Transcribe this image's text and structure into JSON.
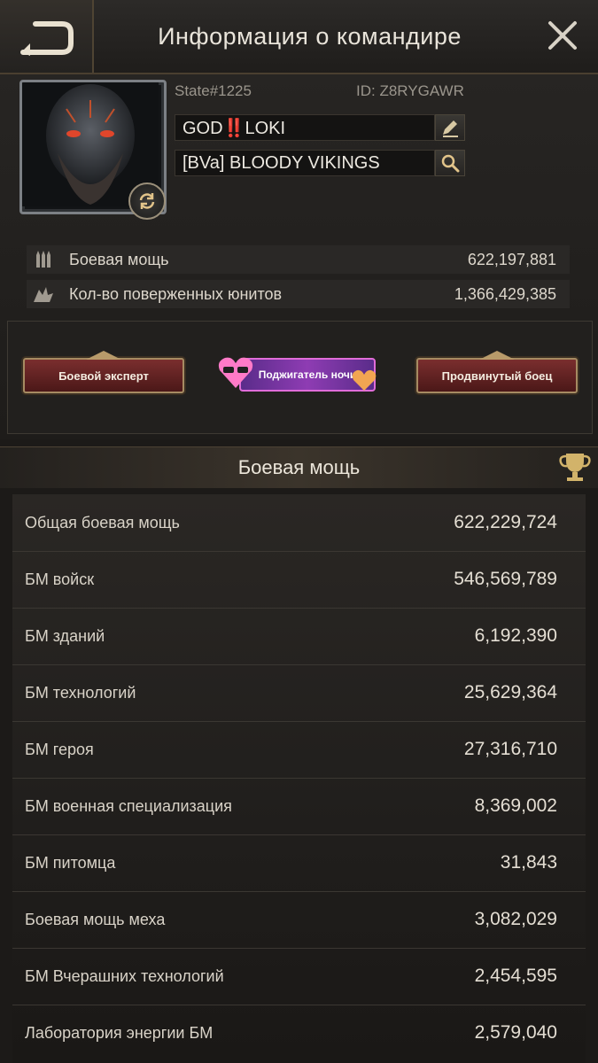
{
  "header": {
    "title": "Информация о командире"
  },
  "profile": {
    "state": "State#1225",
    "id": "ID: Z8RYGAWR",
    "name": "GOD‼️LOKI",
    "alliance": "[BVa] BLOODY VIKINGS"
  },
  "stats": [
    {
      "label": "Боевая мощь",
      "value": "622,197,881",
      "icon": "bullets-icon"
    },
    {
      "label": "Кол-во поверженных юнитов",
      "value": "1,366,429,385",
      "icon": "kills-icon"
    }
  ],
  "badges": {
    "left": "Боевой эксперт",
    "center": "Поджигатель ночи",
    "right": "Продвинутый боец"
  },
  "power": {
    "title": "Боевая мощь",
    "rows": [
      {
        "label": "Общая боевая мощь",
        "value": "622,229,724"
      },
      {
        "label": "БМ войск",
        "value": "546,569,789"
      },
      {
        "label": "БМ зданий",
        "value": "6,192,390"
      },
      {
        "label": "БМ технологий",
        "value": "25,629,364"
      },
      {
        "label": "БМ героя",
        "value": "27,316,710"
      },
      {
        "label": "БМ военная специализация",
        "value": "8,369,002"
      },
      {
        "label": "БМ питомца",
        "value": "31,843"
      },
      {
        "label": "Боевая мощь меха",
        "value": "3,082,029"
      },
      {
        "label": "БМ Вчерашних технологий",
        "value": "2,454,595"
      },
      {
        "label": "Лаборатория энергии БМ",
        "value": "2,579,040"
      }
    ]
  },
  "colors": {
    "accent": "#c9a86a",
    "background": "#1c1a18"
  }
}
